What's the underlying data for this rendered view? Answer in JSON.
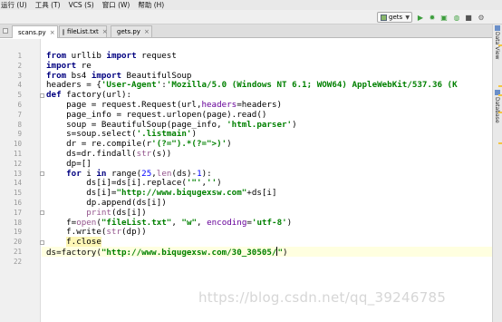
{
  "menu": {
    "items": [
      "运行 (U)",
      "工具 (T)",
      "VCS (S)",
      "窗口 (W)",
      "帮助 (H)"
    ]
  },
  "toolbar": {
    "run_config": "gets",
    "icons": [
      "run-icon",
      "debug-icon",
      "coverage-icon",
      "profile-icon",
      "stop-icon",
      "more-icon"
    ]
  },
  "tabs": [
    {
      "label": "scans.py",
      "close": "×",
      "icon": "python-file-icon",
      "active": true
    },
    {
      "label": "fileList.txt",
      "close": "×",
      "icon": "text-file-icon",
      "active": false
    },
    {
      "label": "gets.py",
      "close": "×",
      "icon": "python-file-icon",
      "active": false
    }
  ],
  "right_panel": {
    "tab1": "Data View",
    "tab2": "Database"
  },
  "editor": {
    "line_numbers": [
      "1",
      "2",
      "3",
      "4",
      "5",
      "6",
      "7",
      "8",
      "9",
      "10",
      "11",
      "12",
      "13",
      "14",
      "15",
      "16",
      "17",
      "18",
      "19",
      "20",
      "21",
      "22"
    ],
    "lines": [
      [
        {
          "t": "from",
          "c": "kw"
        },
        {
          "t": " urllib "
        },
        {
          "t": "import",
          "c": "kw"
        },
        {
          "t": " request"
        }
      ],
      [
        {
          "t": "import",
          "c": "kw"
        },
        {
          "t": " re"
        }
      ],
      [
        {
          "t": "from",
          "c": "kw"
        },
        {
          "t": " bs4 "
        },
        {
          "t": "import",
          "c": "kw"
        },
        {
          "t": " BeautifulSoup"
        }
      ],
      [
        {
          "t": "headers = {"
        },
        {
          "t": "'User-Agent'",
          "c": "str"
        },
        {
          "t": ":"
        },
        {
          "t": "'Mozilla/5.0 (Windows NT 6.1; WOW64) AppleWebKit/537.36 (K",
          "c": "str"
        }
      ],
      [
        {
          "t": "def",
          "c": "kw"
        },
        {
          "t": " factory(url):"
        }
      ],
      [
        {
          "t": "    page = request.Request(url,"
        },
        {
          "t": "headers",
          "c": "kwarg"
        },
        {
          "t": "=headers)"
        }
      ],
      [
        {
          "t": "    page_info = request.urlopen(page).read()"
        }
      ],
      [
        {
          "t": "    soup = BeautifulSoup(page_info, "
        },
        {
          "t": "'html.parser'",
          "c": "str"
        },
        {
          "t": ")"
        }
      ],
      [
        {
          "t": "    s=soup.select("
        },
        {
          "t": "'.listmain'",
          "c": "str"
        },
        {
          "t": ")"
        }
      ],
      [
        {
          "t": "    dr = re.compile(r"
        },
        {
          "t": "'(?=\").*(?=\">)'",
          "c": "str"
        },
        {
          "t": ")"
        }
      ],
      [
        {
          "t": "    ds=dr.findall("
        },
        {
          "t": "str",
          "c": "selfc"
        },
        {
          "t": "(s))"
        }
      ],
      [
        {
          "t": "    dp=[]"
        }
      ],
      [
        {
          "t": "    "
        },
        {
          "t": "for",
          "c": "kw"
        },
        {
          "t": " i "
        },
        {
          "t": "in",
          "c": "kw"
        },
        {
          "t": " range("
        },
        {
          "t": "25",
          "c": "num"
        },
        {
          "t": ","
        },
        {
          "t": "len",
          "c": "selfc"
        },
        {
          "t": "(ds)-"
        },
        {
          "t": "1",
          "c": "num"
        },
        {
          "t": "):"
        }
      ],
      [
        {
          "t": "        ds[i]=ds[i].replace("
        },
        {
          "t": "'\"'",
          "c": "str"
        },
        {
          "t": ","
        },
        {
          "t": "''",
          "c": "str"
        },
        {
          "t": ")"
        }
      ],
      [
        {
          "t": "        ds[i]="
        },
        {
          "t": "\"http://www.biqugexsw.com\"",
          "c": "str"
        },
        {
          "t": "+ds[i]"
        }
      ],
      [
        {
          "t": "        dp.append(ds[i])"
        }
      ],
      [
        {
          "t": "        "
        },
        {
          "t": "print",
          "c": "selfc"
        },
        {
          "t": "(ds[i])"
        }
      ],
      [
        {
          "t": "    f="
        },
        {
          "t": "open",
          "c": "selfc"
        },
        {
          "t": "("
        },
        {
          "t": "\"fileList.txt\"",
          "c": "str"
        },
        {
          "t": ", "
        },
        {
          "t": "\"w\"",
          "c": "str"
        },
        {
          "t": ", "
        },
        {
          "t": "encoding",
          "c": "kwarg"
        },
        {
          "t": "="
        },
        {
          "t": "'utf-8'",
          "c": "str"
        },
        {
          "t": ")"
        }
      ],
      [
        {
          "t": "    f.write("
        },
        {
          "t": "str",
          "c": "selfc"
        },
        {
          "t": "(dp))"
        }
      ],
      [
        {
          "t": "    "
        },
        {
          "t": "f.close",
          "c": "hl"
        }
      ],
      [
        {
          "t": "ds=factory("
        },
        {
          "t": "\"http://www.biqugexsw.com/30_30505/",
          "c": "str"
        },
        {
          "t": "CARET",
          "c": "caret"
        },
        {
          "t": "\"",
          "c": "str"
        },
        {
          "t": ")"
        }
      ],
      []
    ]
  },
  "watermark": "https://blog.csdn.net/qq_39246785"
}
